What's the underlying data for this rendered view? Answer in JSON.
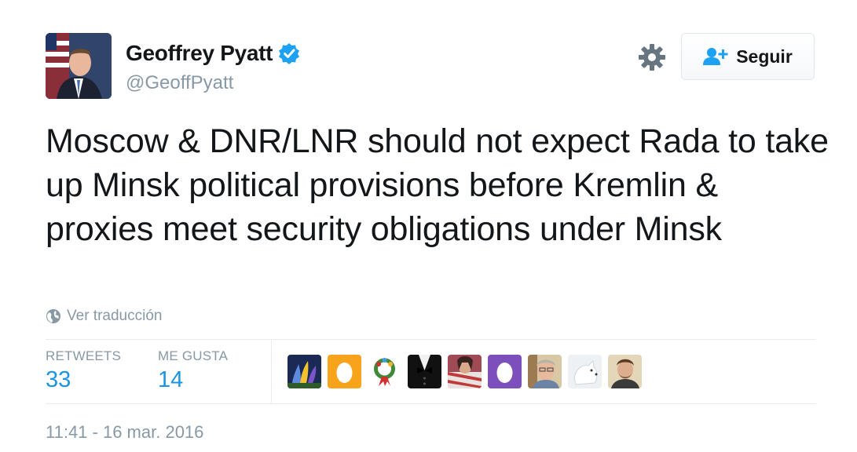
{
  "tweet": {
    "author": {
      "name": "Geoffrey Pyatt",
      "handle": "@GeoffPyatt",
      "verified": true
    },
    "follow_button_label": "Seguir",
    "text": "Moscow & DNR/LNR should not expect Rada to take up Minsk political provisions before Kremlin & proxies meet security obligations under Minsk",
    "translate_label": "Ver traducción",
    "stats": {
      "retweets_label": "RETWEETS",
      "retweets_value": "33",
      "likes_label": "ME GUSTA",
      "likes_value": "14"
    },
    "timestamp": "11:41 - 16 mar. 2016"
  },
  "icons": {
    "verified": "verified-badge-icon",
    "settings": "gear-icon",
    "follow": "add-user-icon",
    "translate": "globe-icon"
  },
  "colors": {
    "accent": "#1b95e0",
    "verified": "#1da1f2",
    "muted": "#8899a6",
    "text": "#14171a"
  }
}
